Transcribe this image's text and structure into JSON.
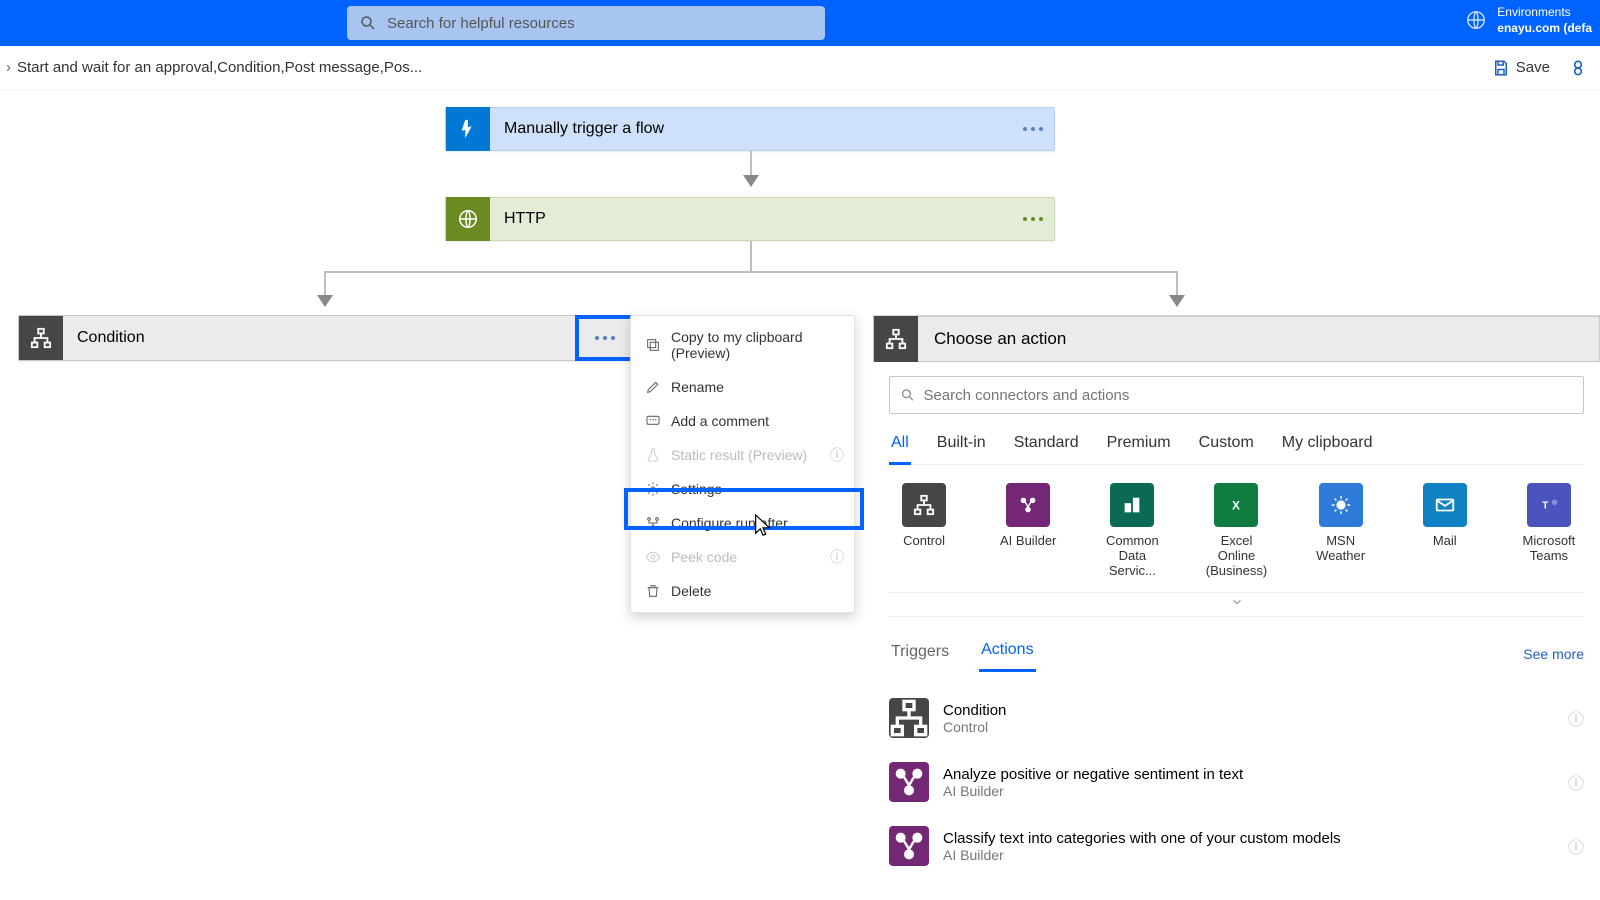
{
  "topbar": {
    "search_placeholder": "Search for helpful resources",
    "env_label": "Environments",
    "env_name": "enayu.com (defa"
  },
  "cmdbar": {
    "breadcrumb": "Start and wait for an approval,Condition,Post message,Pos...",
    "save_label": "Save"
  },
  "flow": {
    "trigger_title": "Manually trigger a flow",
    "http_title": "HTTP",
    "condition_title": "Condition"
  },
  "ctx": {
    "copy": "Copy to my clipboard (Preview)",
    "rename": "Rename",
    "add_comment": "Add a comment",
    "static_result": "Static result (Preview)",
    "settings": "Settings",
    "configure": "Configure run after",
    "peek": "Peek code",
    "delete": "Delete"
  },
  "panel": {
    "title": "Choose an action",
    "search_placeholder": "Search connectors and actions",
    "tabs1": [
      "All",
      "Built-in",
      "Standard",
      "Premium",
      "Custom",
      "My clipboard"
    ],
    "connectors": [
      {
        "label": "Control",
        "color": "#484644"
      },
      {
        "label": "AI Builder",
        "color": "#742774"
      },
      {
        "label": "Common Data Servic...",
        "color": "#0b6a53"
      },
      {
        "label": "Excel Online (Business)",
        "color": "#107c41"
      },
      {
        "label": "MSN Weather",
        "color": "#2f7bd9"
      },
      {
        "label": "Mail",
        "color": "#1081c2"
      },
      {
        "label": "Microsoft Teams",
        "color": "#4b53bc"
      }
    ],
    "tabs2": [
      "Triggers",
      "Actions"
    ],
    "seemore": "See more",
    "actions": [
      {
        "title": "Condition",
        "sub": "Control",
        "color": "#484644"
      },
      {
        "title": "Analyze positive or negative sentiment in text",
        "sub": "AI Builder",
        "color": "#742774"
      },
      {
        "title": "Classify text into categories with one of your custom models",
        "sub": "AI Builder",
        "color": "#742774"
      }
    ]
  }
}
